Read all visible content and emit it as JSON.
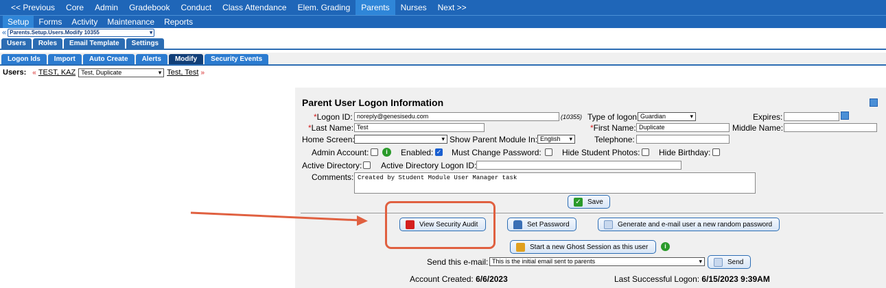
{
  "topnav": [
    "<< Previous",
    "Core",
    "Admin",
    "Gradebook",
    "Conduct",
    "Class Attendance",
    "Elem. Grading",
    "Parents",
    "Nurses",
    "Next >>"
  ],
  "topnav_active": "Parents",
  "subnav": [
    "Setup",
    "Forms",
    "Activity",
    "Maintenance",
    "Reports"
  ],
  "path": {
    "chevron": "«",
    "value": "Parents.Setup.Users.Modify 10355"
  },
  "tabs": [
    "Users",
    "Roles",
    "Email Template",
    "Settings"
  ],
  "tabs2": [
    "Logon Ids",
    "Import",
    "Auto Create",
    "Alerts",
    "Modify",
    "Security Events"
  ],
  "users_row": {
    "label": "Users:",
    "prev_link": "TEST, KAZ",
    "selected": "Test, Duplicate",
    "next_link": "Test, Test",
    "prev_arrow": "«",
    "next_arrow": "»"
  },
  "panel": {
    "title": "Parent User Logon Information",
    "logon_id_label": "Logon ID:",
    "logon_id_value": "noreply@genesisedu.com",
    "id_number": "(10355)",
    "type_label": "Type of logon:",
    "type_value": "Guardian",
    "expires_label": "Expires:",
    "expires_value": "",
    "last_name_label": "Last Name:",
    "last_name_value": "Test",
    "first_name_label": "First Name:",
    "first_name_value": "Duplicate",
    "middle_name_label": "Middle Name:",
    "middle_name_value": "",
    "home_screen_label": "Home Screen:",
    "home_screen_value": "",
    "show_module_label": "Show Parent Module In:",
    "show_module_value": "English",
    "telephone_label": "Telephone:",
    "telephone_value": "",
    "admin_label": "Admin Account:",
    "enabled_label": "Enabled:",
    "must_change_label": "Must Change Password:",
    "hide_photos_label": "Hide Student Photos:",
    "hide_birthday_label": "Hide Birthday:",
    "ad_label": "Active Directory:",
    "ad_logon_label": "Active Directory Logon ID:",
    "ad_logon_value": "",
    "comments_label": "Comments:",
    "comments_value": "Created by Student Module User Manager task",
    "save_label": "Save",
    "view_audit_label": "View Security Audit",
    "set_password_label": "Set Password",
    "generate_label": "Generate and e-mail user a new random password",
    "ghost_label": "Start a new Ghost Session as this user",
    "send_email_label": "Send this e-mail:",
    "send_email_value": "This is the initial email sent to parents",
    "send_label": "Send",
    "account_created_label": "Account Created:",
    "account_created_value": "6/6/2023",
    "last_logon_label": "Last Successful Logon:",
    "last_logon_value": "6/15/2023 9:39AM"
  },
  "colors": {
    "nav_blue": "#1f66b8",
    "active_blue": "#2f86d8",
    "tab_dark": "#123f78",
    "highlight_red": "#e06040"
  }
}
